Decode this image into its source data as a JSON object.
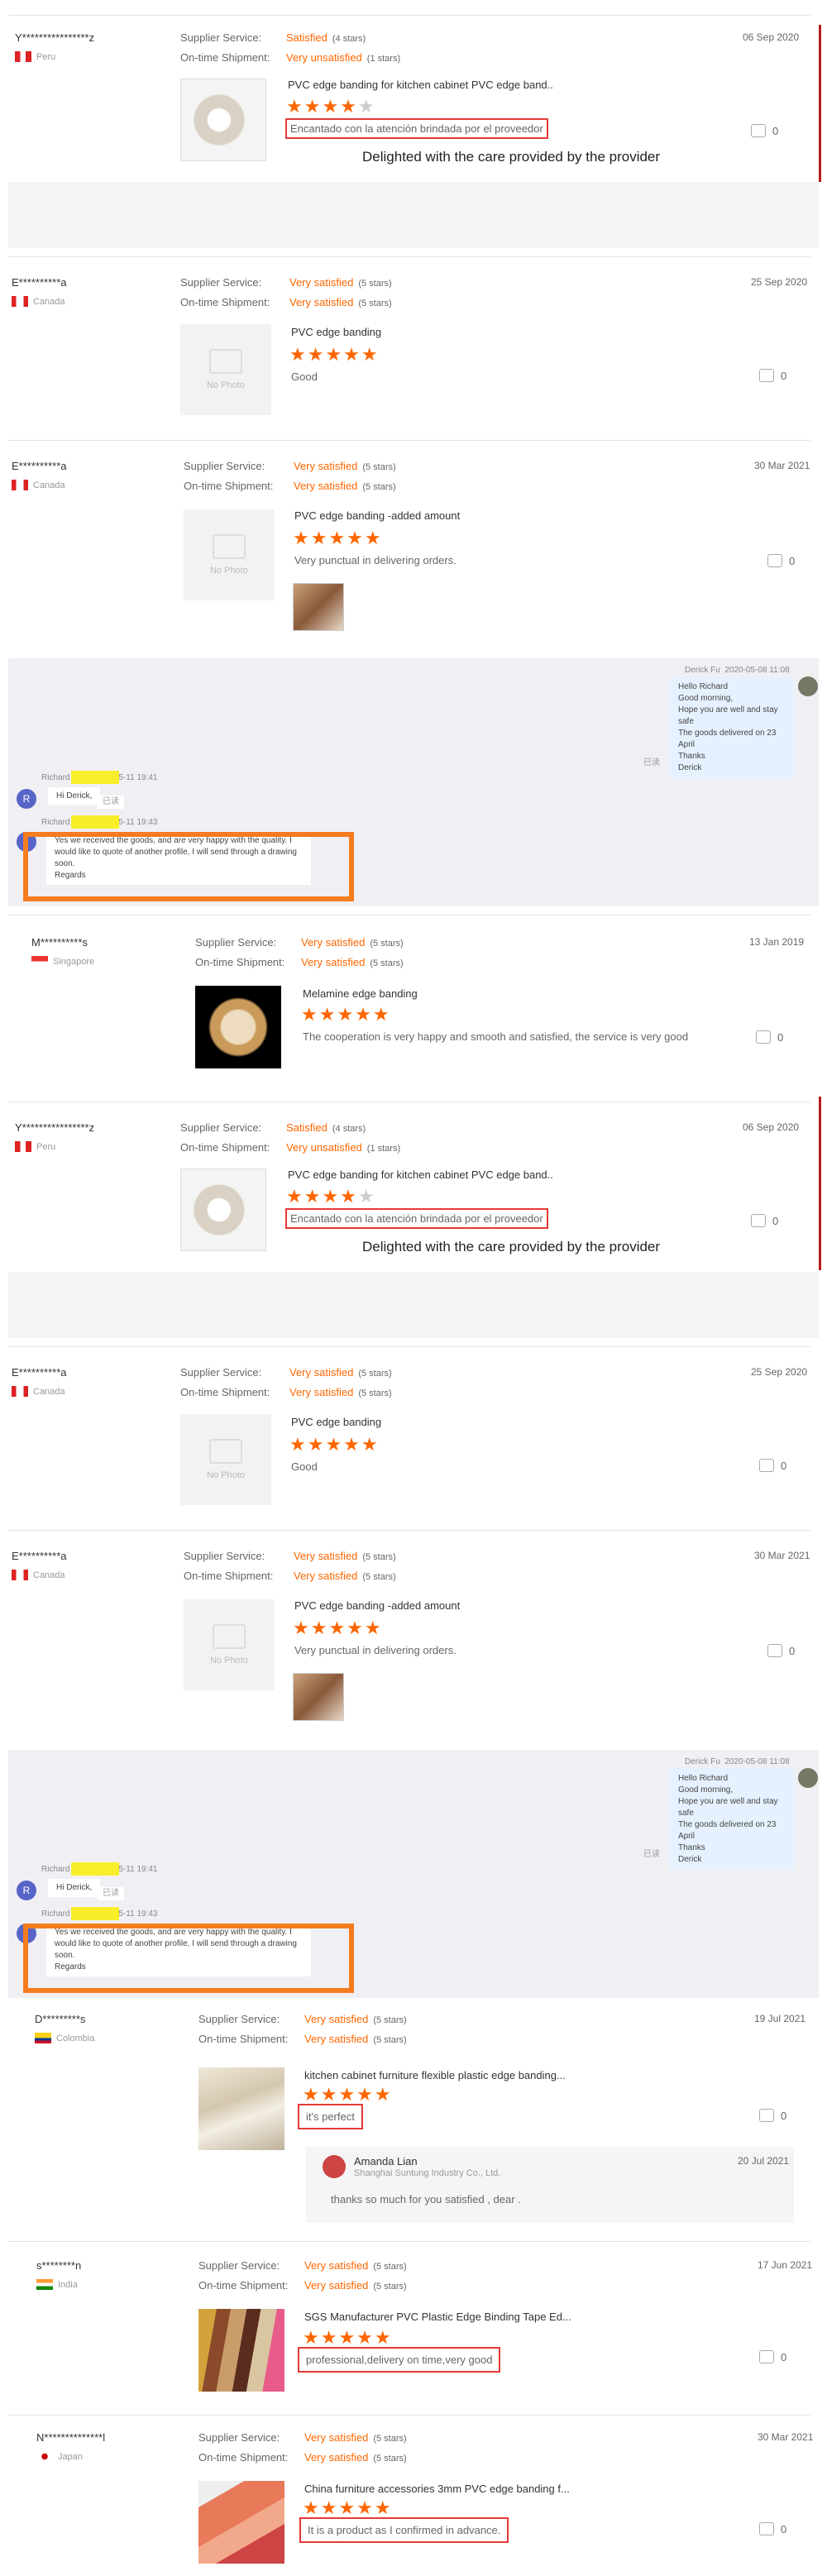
{
  "labels": {
    "supplier_service": "Supplier Service:",
    "ontime": "On-time Shipment:",
    "no_photo": "No Photo"
  },
  "r1": {
    "user": "Y****************z",
    "country": "Peru",
    "service": "Satisfied",
    "service_stars": "(4 stars)",
    "ontime": "Very unsatisfied",
    "ontime_stars": "(1 stars)",
    "date": "06 Sep 2020",
    "product": "PVC edge banding for kitchen cabinet PVC edge band..",
    "rating": 4,
    "review": "Encantado con la atención brindada por el proveedor",
    "translation": "Delighted with the care provided by the provider",
    "likes": "0"
  },
  "r2": {
    "user": "E**********a",
    "country": "Canada",
    "service": "Very satisfied",
    "service_stars": "(5 stars)",
    "ontime": "Very satisfied",
    "ontime_stars": "(5 stars)",
    "date": "25 Sep 2020",
    "product": "PVC edge banding",
    "rating": 5,
    "review": "Good",
    "likes": "0"
  },
  "r3": {
    "user": "E**********a",
    "country": "Canada",
    "service": "Very satisfied",
    "service_stars": "(5 stars)",
    "ontime": "Very satisfied",
    "ontime_stars": "(5 stars)",
    "date": "30 Mar 2021",
    "product": "PVC edge banding -added amount",
    "rating": 5,
    "review": "Very punctual in delivering orders.",
    "likes": "0"
  },
  "chat": {
    "sender": "Derick Fu",
    "sent_time": "2020-05-08 11:08",
    "lines": [
      "Hello Richard",
      "Good morning,",
      "Hope you are well and stay safe",
      "The goods delivered on 23 April",
      "Thanks",
      "Derick"
    ],
    "read": "已读",
    "richard_time1": "2020-05-11 19:41",
    "hi": "Hi Derick,",
    "time2": "2020-05-11 19:43",
    "reply_lines": [
      "Yes we received the goods, and are very happy with the quality. I",
      "would like to quote of another profile, I will send through a drawing",
      "soon.",
      "Regards"
    ],
    "badge": "R",
    "name1": "Richard",
    "name2": "Richard"
  },
  "r4": {
    "user": "M**********s",
    "country": "Singapore",
    "service": "Very satisfied",
    "service_stars": "(5 stars)",
    "ontime": "Very satisfied",
    "ontime_stars": "(5 stars)",
    "date": "13 Jan 2019",
    "product": "Melamine edge banding",
    "rating": 5,
    "review": "The cooperation is very happy and smooth and satisfied, the service is very good",
    "likes": "0"
  },
  "r7": {
    "user": "D*********s",
    "country": "Colombia",
    "service": "Very satisfied",
    "service_stars": "(5 stars)",
    "ontime": "Very satisfied",
    "ontime_stars": "(5 stars)",
    "date": "19 Jul 2021",
    "product": "kitchen cabinet furniture flexible plastic edge banding...",
    "rating": 5,
    "review": "it's perfect",
    "likes": "0",
    "reply_name": "Amanda Lian",
    "reply_company": "Shanghai Suntung Industry Co., Ltd.",
    "reply_date": "20 Jul 2021",
    "reply_text": "thanks so  much for you satisfied , dear ."
  },
  "r8": {
    "user": "s********n",
    "country": "India",
    "service": "Very satisfied",
    "service_stars": "(5 stars)",
    "ontime": "Very satisfied",
    "ontime_stars": "(5 stars)",
    "date": "17 Jun 2021",
    "product": "SGS Manufacturer PVC Plastic Edge Binding Tape Ed...",
    "rating": 5,
    "review": "professional,delivery on time,very good",
    "likes": "0"
  },
  "r9": {
    "user": "N**************l",
    "country": "Japan",
    "service": "Very satisfied",
    "service_stars": "(5 stars)",
    "ontime": "Very satisfied",
    "ontime_stars": "(5 stars)",
    "date": "30 Mar 2021",
    "product": "China furniture accessories 3mm PVC edge banding f...",
    "rating": 5,
    "review": "It is a product as I confirmed in advance.",
    "likes": "0"
  }
}
